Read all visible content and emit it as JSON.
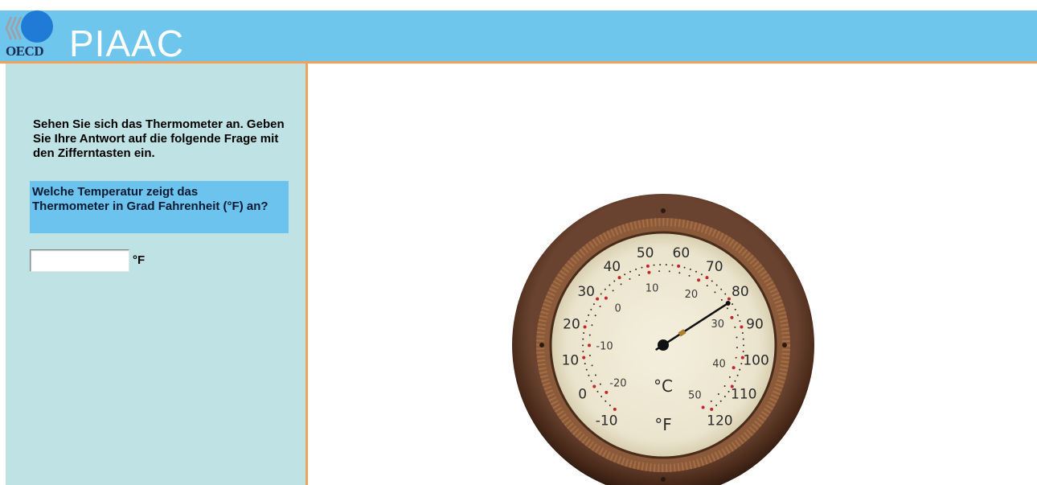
{
  "header": {
    "logo_text": "OECD",
    "title": "PIAAC",
    "colors": {
      "bar": "#6fc6ec",
      "accent": "#f0a15c",
      "logo_circle": "#1f7bd6"
    }
  },
  "left_panel": {
    "instructions": "Sehen Sie sich das Thermometer an. Geben Sie Ihre Antwort auf die folgende Frage mit den Zifferntasten ein.",
    "question": "Welche Temperatur zeigt das Thermometer in Grad Fahrenheit (°F) an?",
    "answer": {
      "value": "",
      "placeholder": ""
    },
    "unit_label": "°F"
  },
  "thermometer": {
    "fahrenheit_labels": [
      "-10",
      "0",
      "10",
      "20",
      "30",
      "40",
      "50",
      "60",
      "70",
      "80",
      "90",
      "100",
      "110",
      "120"
    ],
    "celsius_labels": [
      "-20",
      "-10",
      "0",
      "10",
      "20",
      "30",
      "40",
      "50"
    ],
    "celsius_unit": "°C",
    "fahrenheit_unit": "°F",
    "needle_reading_f": 81,
    "colors": {
      "face": "#efe9d6",
      "rim": "#5a3624",
      "tick_red": "#c0262c"
    }
  }
}
